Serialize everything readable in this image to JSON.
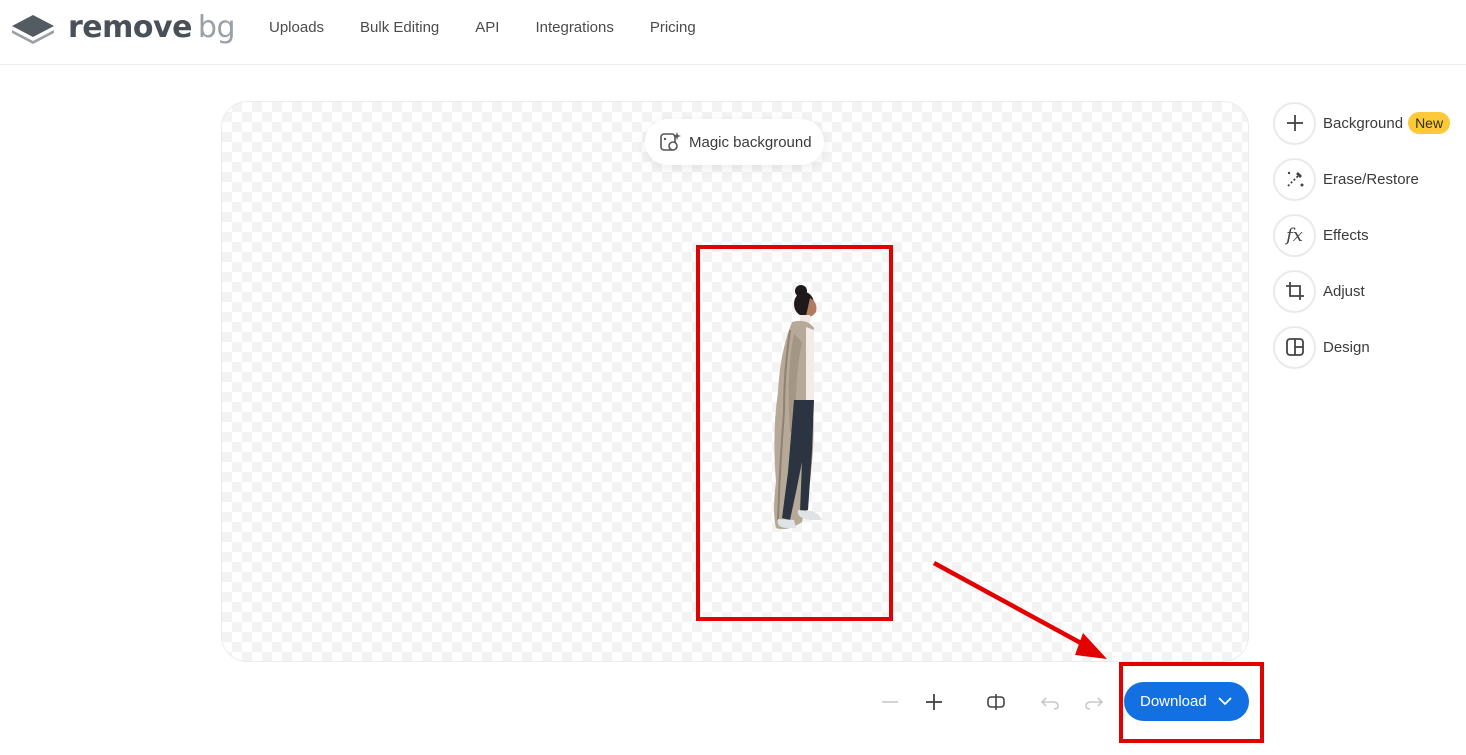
{
  "header": {
    "logo": {
      "word1": "remove",
      "word2": "bg"
    },
    "nav": [
      {
        "label": "Uploads"
      },
      {
        "label": "Bulk Editing"
      },
      {
        "label": "API"
      },
      {
        "label": "Integrations"
      },
      {
        "label": "Pricing"
      }
    ]
  },
  "canvas": {
    "magic_background_label": "Magic background"
  },
  "tools": {
    "background": {
      "label": "Background",
      "badge": "New"
    },
    "erase": {
      "label": "Erase/Restore"
    },
    "effects": {
      "label": "Effects",
      "icon_text": "fx"
    },
    "adjust": {
      "label": "Adjust"
    },
    "design": {
      "label": "Design"
    }
  },
  "toolbar": {
    "download_label": "Download"
  },
  "colors": {
    "primary": "#1370e3",
    "badge": "#fbc93a",
    "annotation": "#e30000"
  }
}
